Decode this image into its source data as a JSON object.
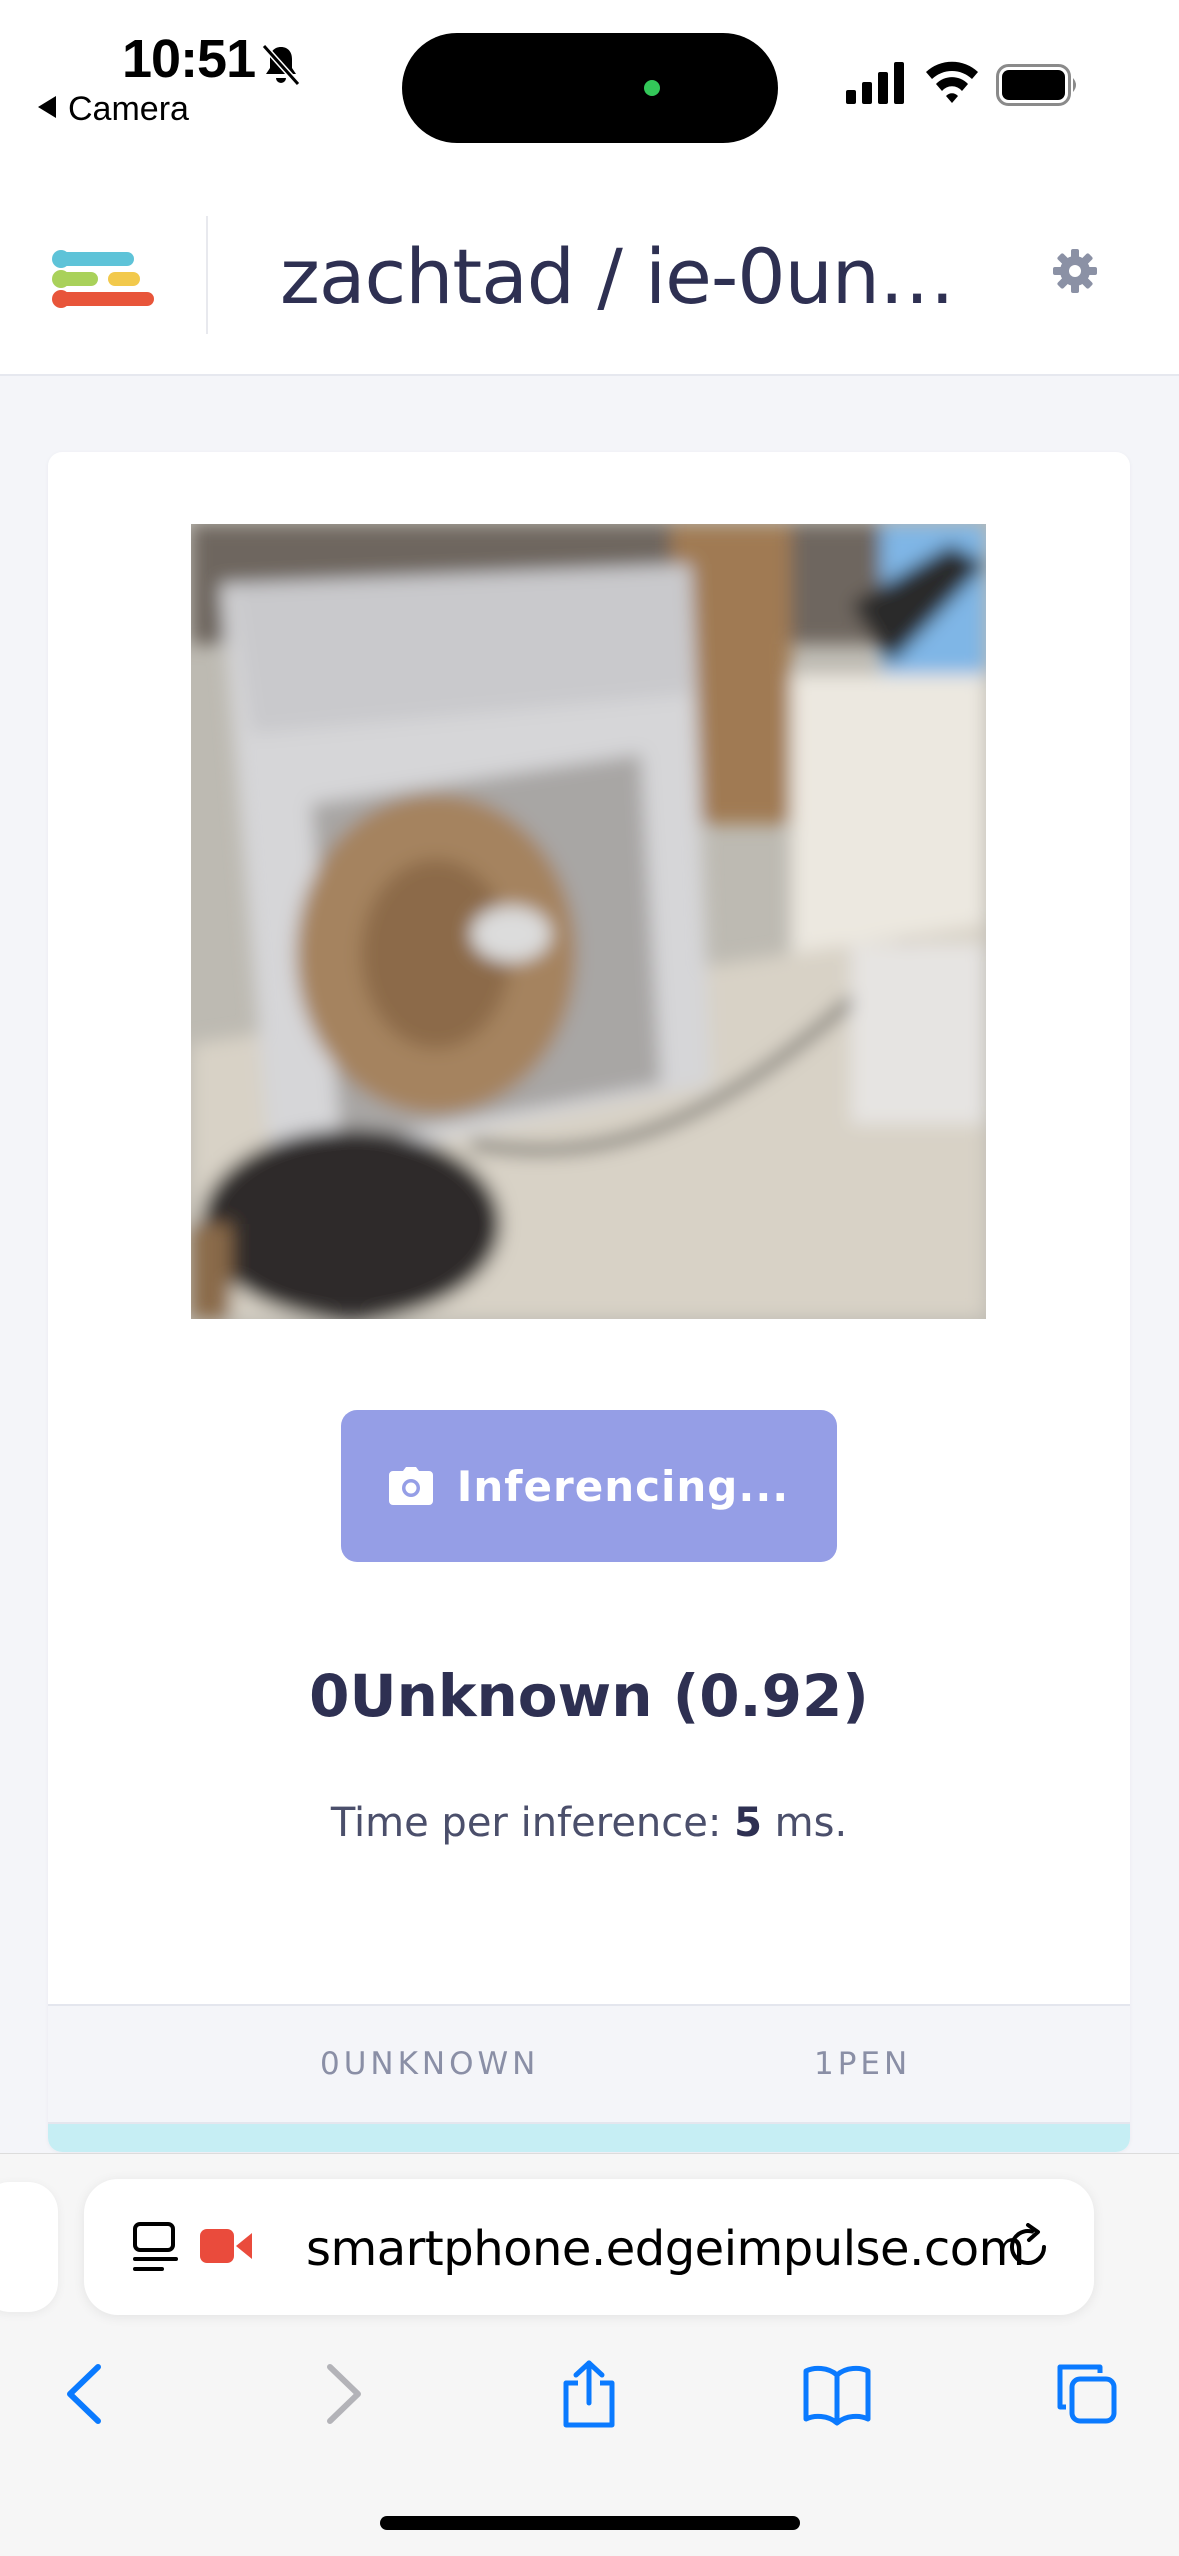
{
  "status_bar": {
    "time": "10:51",
    "back_app": "Camera",
    "icons": [
      "bell-slash-icon",
      "cellular-signal-icon",
      "wifi-icon",
      "battery-icon"
    ]
  },
  "header": {
    "project_title": "zachtad / ie-0unk...",
    "icons": [
      "edge-impulse-logo-icon",
      "gear-icon"
    ]
  },
  "camera": {
    "feed_description_icon": "camera-feed-image"
  },
  "inference": {
    "button_label": "Inferencing...",
    "button_icon": "camera-icon",
    "result": "0Unknown (0.92)",
    "time_prefix": "Time per inference: ",
    "time_value": "5",
    "time_suffix": " ms."
  },
  "classes": {
    "columns": [
      "0UNKNOWN",
      "1PEN"
    ]
  },
  "browser": {
    "url": "smartphone.edgeimpulse.com",
    "icons": [
      "page-menu-icon",
      "screen-recording-icon",
      "reload-icon",
      "back-icon",
      "forward-icon",
      "share-icon",
      "bookmarks-icon",
      "tabs-icon"
    ]
  },
  "colors": {
    "button_bg": "#959ee6",
    "title_text": "#2e3052",
    "highlight_row": "#c6eef4",
    "accent_blue": "#0a7aff"
  }
}
